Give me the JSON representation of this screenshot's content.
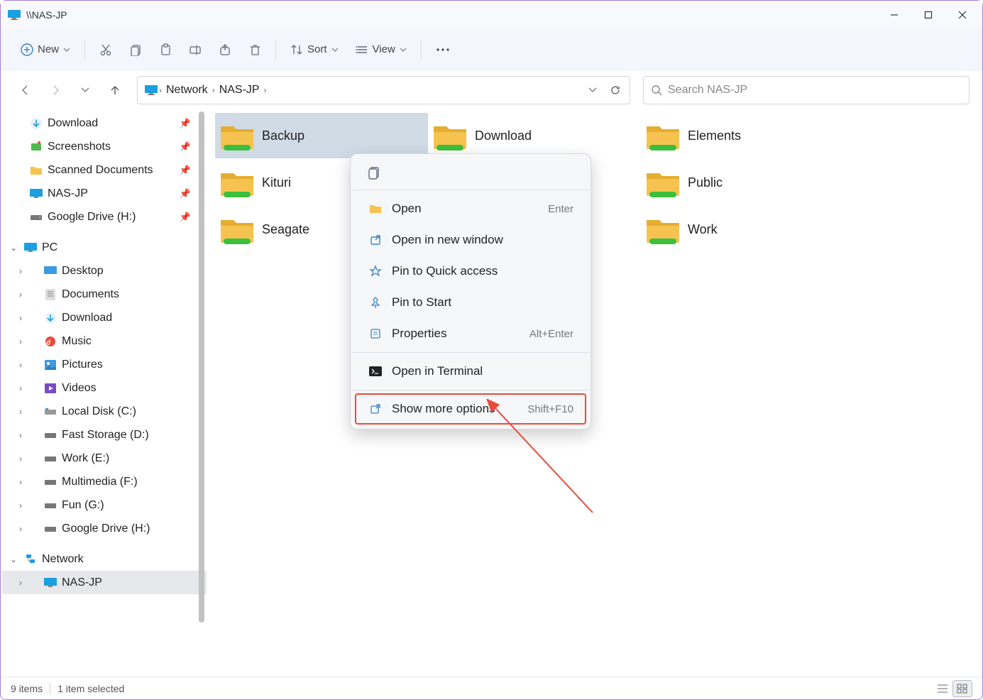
{
  "window": {
    "title": "\\\\NAS-JP"
  },
  "toolbar": {
    "new": "New",
    "sort": "Sort",
    "view": "View"
  },
  "breadcrumb": {
    "root": "Network",
    "child": "NAS-JP"
  },
  "search": {
    "placeholder": "Search NAS-JP"
  },
  "quick_access": [
    {
      "label": "Download",
      "icon": "download"
    },
    {
      "label": "Screenshots",
      "icon": "screenshots"
    },
    {
      "label": "Scanned Documents",
      "icon": "folder"
    },
    {
      "label": "NAS-JP",
      "icon": "monitor"
    },
    {
      "label": "Google Drive (H:)",
      "icon": "drive"
    }
  ],
  "this_pc": {
    "label": "PC",
    "children": [
      {
        "label": "Desktop",
        "icon": "desktop"
      },
      {
        "label": "Documents",
        "icon": "documents"
      },
      {
        "label": "Download",
        "icon": "download"
      },
      {
        "label": "Music",
        "icon": "music"
      },
      {
        "label": "Pictures",
        "icon": "pictures"
      },
      {
        "label": "Videos",
        "icon": "videos"
      },
      {
        "label": "Local Disk (C:)",
        "icon": "localdisk"
      },
      {
        "label": "Fast Storage (D:)",
        "icon": "drive"
      },
      {
        "label": "Work (E:)",
        "icon": "drive"
      },
      {
        "label": "Multimedia (F:)",
        "icon": "drive"
      },
      {
        "label": "Fun (G:)",
        "icon": "drive"
      },
      {
        "label": "Google Drive (H:)",
        "icon": "drive"
      }
    ]
  },
  "network": {
    "label": "Network",
    "children": [
      {
        "label": "NAS-JP",
        "icon": "monitor"
      }
    ]
  },
  "folders": [
    {
      "name": "Backup",
      "selected": true
    },
    {
      "name": "Download",
      "selected": false
    },
    {
      "name": "Elements",
      "selected": false
    },
    {
      "name": "Kituri",
      "selected": false
    },
    {
      "name": "",
      "selected": false,
      "hidden_by_menu": true
    },
    {
      "name": "Public",
      "selected": false
    },
    {
      "name": "Seagate",
      "selected": false
    },
    {
      "name": "",
      "selected": false,
      "hidden_by_menu": true
    },
    {
      "name": "Work",
      "selected": false
    }
  ],
  "context_menu": {
    "open": "Open",
    "open_shortcut": "Enter",
    "open_new_window": "Open in new window",
    "pin_quick": "Pin to Quick access",
    "pin_start": "Pin to Start",
    "properties": "Properties",
    "properties_shortcut": "Alt+Enter",
    "open_terminal": "Open in Terminal",
    "show_more": "Show more options",
    "show_more_shortcut": "Shift+F10"
  },
  "status": {
    "items": "9 items",
    "selected": "1 item selected"
  }
}
